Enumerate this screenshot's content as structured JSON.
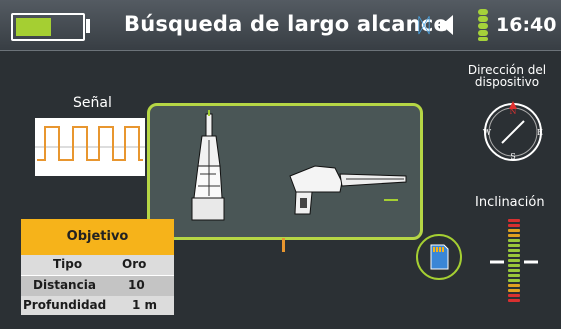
{
  "header": {
    "title": "Búsqueda de largo alcance",
    "time": "16:40",
    "battery_level": 0.55,
    "bluetooth_icon": "bluetooth-icon",
    "sound_icon": "speaker-icon",
    "signal_icon": "signal-bars-icon"
  },
  "signal": {
    "label": "Señal"
  },
  "device_direction": {
    "label": "Dirección del dispositivo",
    "north": "N",
    "south": "S",
    "east": "E",
    "west": "W"
  },
  "inclination": {
    "label": "Inclinación"
  },
  "objective": {
    "title": "Objetivo",
    "rows": [
      {
        "key": "Tipo",
        "value": "Oro"
      },
      {
        "key": "Distancia",
        "value": "10"
      },
      {
        "key": "Profundidad",
        "value": "1 m"
      }
    ]
  },
  "sd_card": {
    "icon": "sd-card-icon"
  },
  "colors": {
    "accent": "#a5cf32",
    "objective_header": "#f6b31a",
    "compass_north": "#e03030",
    "bluetooth": "#4aa3e0",
    "signal_wave": "#e8962f"
  }
}
